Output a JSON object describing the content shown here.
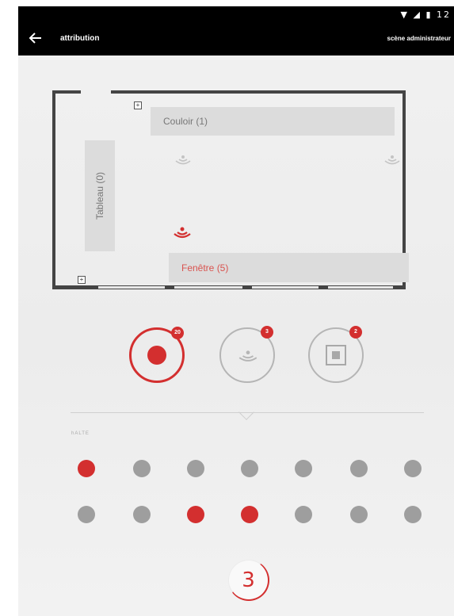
{
  "status_bar": {
    "icons": "▼ ◢ ▮ 12"
  },
  "app_bar": {
    "title": "attribution",
    "account": "scène administrateur"
  },
  "floor_plan": {
    "zone_couloir": "Couloir (1)",
    "zone_fenetre": "Fenêtre (5)",
    "zone_tableau": "Tableau (0)"
  },
  "modes": [
    {
      "name": "active-dot",
      "badge": "20",
      "active": true
    },
    {
      "name": "beacon",
      "badge": "3",
      "active": false
    },
    {
      "name": "square",
      "badge": "2",
      "active": false
    }
  ],
  "section": {
    "label": "hALTE"
  },
  "seats": {
    "row1": [
      true,
      false,
      false,
      false,
      false,
      false,
      false
    ],
    "row2": [
      false,
      false,
      true,
      true,
      false,
      false,
      false
    ]
  },
  "step": {
    "number": "3"
  },
  "colors": {
    "accent": "#d32f2f",
    "inactive": "#9e9e9e",
    "zone": "#dcdcdc"
  }
}
